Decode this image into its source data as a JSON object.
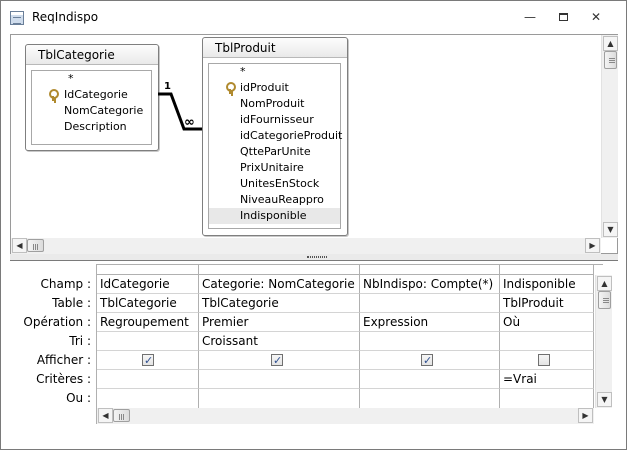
{
  "window": {
    "title": "ReqIndispo"
  },
  "tables": [
    {
      "name": "TblCategorie",
      "fields": [
        {
          "label": "*",
          "key": false
        },
        {
          "label": "IdCategorie",
          "key": true
        },
        {
          "label": "NomCategorie",
          "key": false
        },
        {
          "label": "Description",
          "key": false
        }
      ]
    },
    {
      "name": "TblProduit",
      "fields": [
        {
          "label": "*",
          "key": false
        },
        {
          "label": "idProduit",
          "key": true
        },
        {
          "label": "NomProduit",
          "key": false
        },
        {
          "label": "idFournisseur",
          "key": false
        },
        {
          "label": "idCategorieProduit",
          "key": false
        },
        {
          "label": "QtteParUnite",
          "key": false
        },
        {
          "label": "PrixUnitaire",
          "key": false
        },
        {
          "label": "UnitesEnStock",
          "key": false
        },
        {
          "label": "NiveauReappro",
          "key": false
        },
        {
          "label": "Indisponible",
          "key": false,
          "selected": true
        }
      ]
    }
  ],
  "relationship": {
    "one": "1",
    "many": "∞"
  },
  "grid": {
    "row_labels": [
      "Champ :",
      "Table :",
      "Opération :",
      "Tri :",
      "Afficher :",
      "Critères :",
      "Ou :"
    ],
    "columns": [
      {
        "champ": "IdCategorie",
        "table": "TblCategorie",
        "operation": "Regroupement",
        "tri": "",
        "afficher": true,
        "criteres": ""
      },
      {
        "champ": "Categorie: NomCategorie",
        "table": "TblCategorie",
        "operation": "Premier",
        "tri": "Croissant",
        "afficher": true,
        "criteres": ""
      },
      {
        "champ": "NbIndispo: Compte(*)",
        "table": "",
        "operation": "Expression",
        "tri": "",
        "afficher": true,
        "criteres": ""
      },
      {
        "champ": "Indisponible",
        "table": "TblProduit",
        "operation": "Où",
        "tri": "",
        "afficher": false,
        "criteres": "=Vrai"
      }
    ]
  },
  "icons": {
    "minimize": "minimize-icon",
    "maximize": "maximize-icon",
    "close": "close-icon",
    "key": "primary-key-icon"
  }
}
